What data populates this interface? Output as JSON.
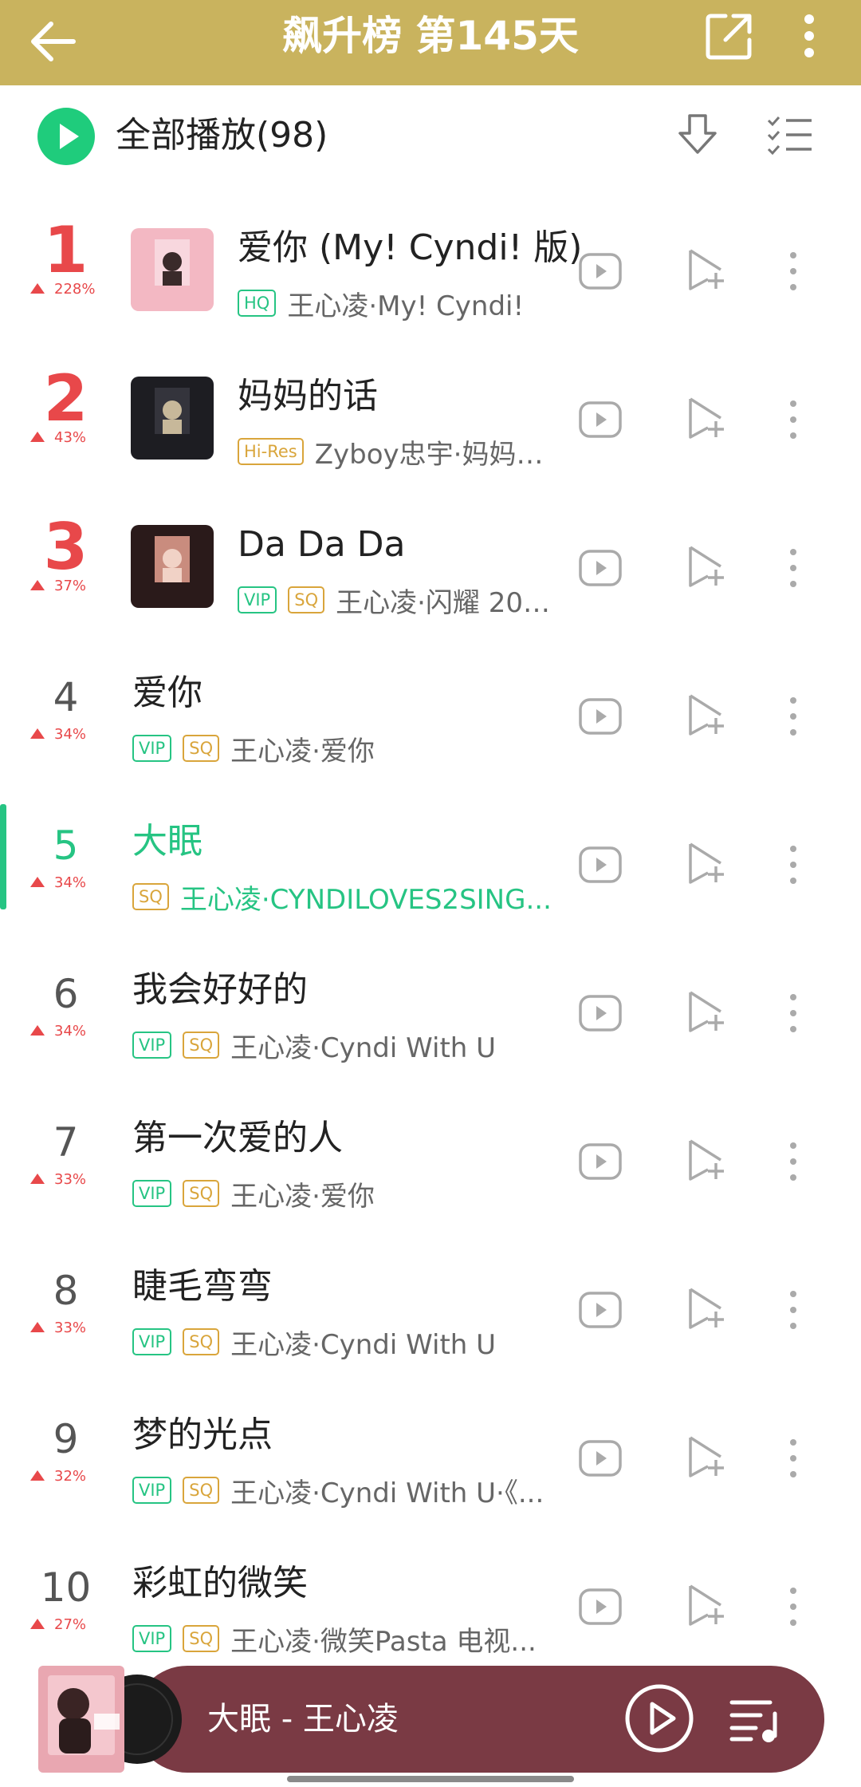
{
  "header": {
    "title": "飙升榜 第145天",
    "bg_color": "#c9b35e"
  },
  "play_all": {
    "label": "全部播放(98)"
  },
  "current_index": 5,
  "songs": [
    {
      "rank": "1",
      "change": "228%",
      "title": "爱你 (My! Cyndi! 版)",
      "tags": [
        "HQ"
      ],
      "artist": "王心凌·My! Cyndi!",
      "has_cover": true
    },
    {
      "rank": "2",
      "change": "43%",
      "title": "妈妈的话",
      "tags": [
        "Hi-Res"
      ],
      "artist": "Zyboy忠宇·妈妈的...",
      "has_cover": true
    },
    {
      "rank": "3",
      "change": "37%",
      "title": "Da Da Da",
      "tags": [
        "VIP",
        "SQ"
      ],
      "artist": "王心凌·闪耀 200...",
      "has_cover": true
    },
    {
      "rank": "4",
      "change": "34%",
      "title": "爱你",
      "tags": [
        "VIP",
        "SQ"
      ],
      "artist": "王心凌·爱你",
      "has_cover": false
    },
    {
      "rank": "5",
      "change": "34%",
      "title": "大眠",
      "tags": [
        "SQ"
      ],
      "artist": "王心凌·CYNDILOVES2SING...",
      "has_cover": false
    },
    {
      "rank": "6",
      "change": "34%",
      "title": "我会好好的",
      "tags": [
        "VIP",
        "SQ"
      ],
      "artist": "王心凌·Cyndi With U",
      "has_cover": false
    },
    {
      "rank": "7",
      "change": "33%",
      "title": "第一次爱的人",
      "tags": [
        "VIP",
        "SQ"
      ],
      "artist": "王心凌·爱你",
      "has_cover": false
    },
    {
      "rank": "8",
      "change": "33%",
      "title": "睫毛弯弯",
      "tags": [
        "VIP",
        "SQ"
      ],
      "artist": "王心凌·Cyndi With U",
      "has_cover": false
    },
    {
      "rank": "9",
      "change": "32%",
      "title": "梦的光点",
      "tags": [
        "VIP",
        "SQ"
      ],
      "artist": "王心凌·Cyndi With U·《...",
      "has_cover": false
    },
    {
      "rank": "10",
      "change": "27%",
      "title": "彩虹的微笑",
      "tags": [
        "VIP",
        "SQ"
      ],
      "artist": "王心凌·微笑Pasta 电视...",
      "has_cover": false
    }
  ],
  "player": {
    "now_playing": "大眠 - 王心凌",
    "bg_color": "#7a3a44"
  },
  "colors": {
    "accent_green": "#26c483",
    "rank_red": "#e8484a",
    "sq_gold": "#d9a53b"
  }
}
